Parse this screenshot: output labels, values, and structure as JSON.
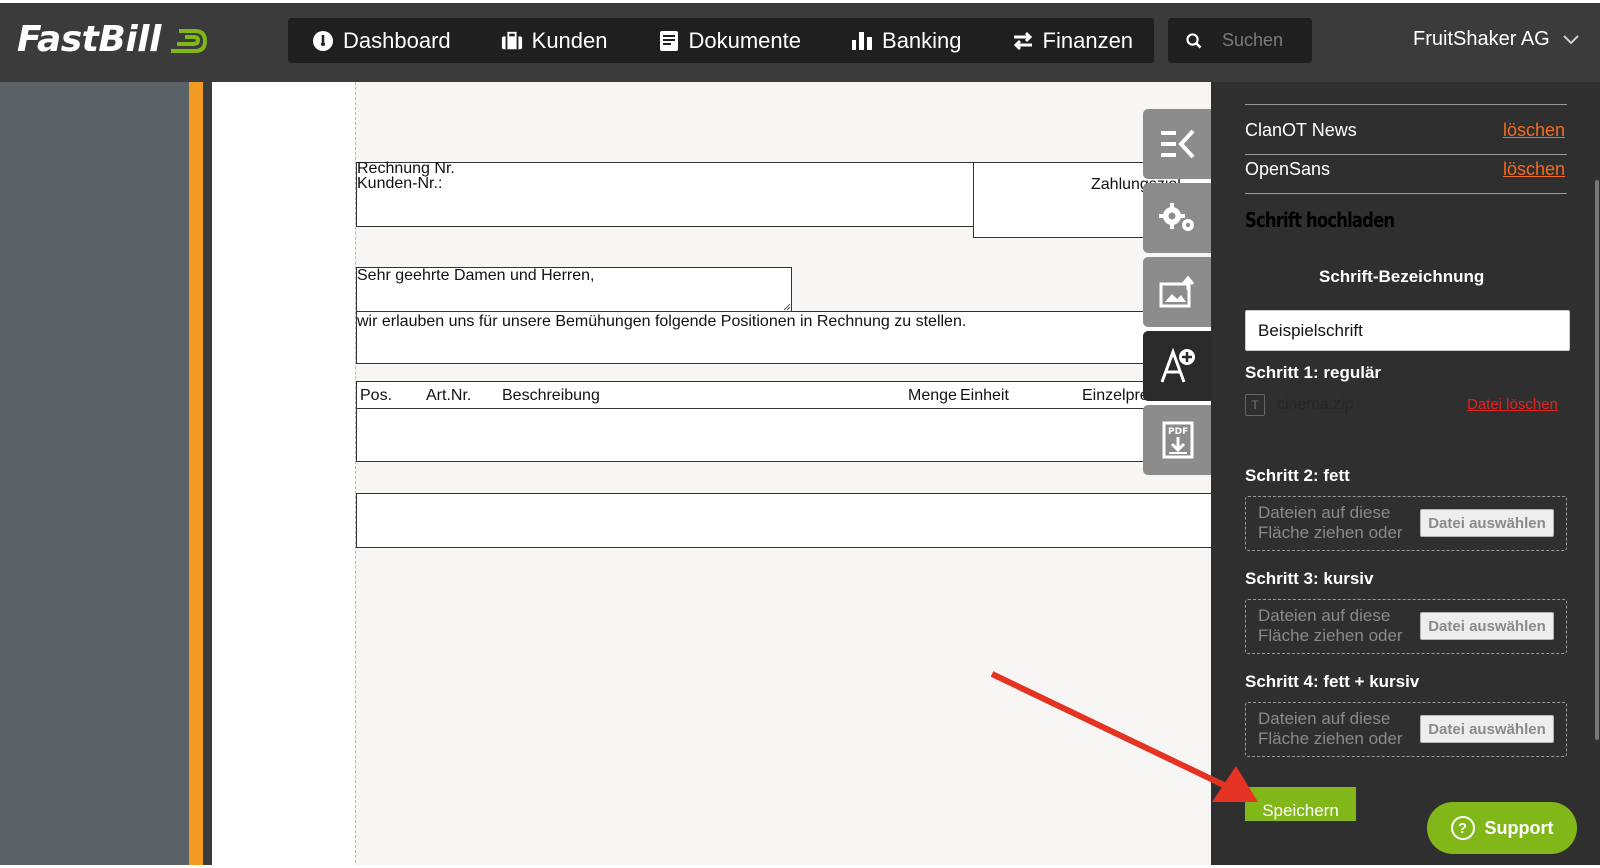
{
  "brand": {
    "name": "FastBill",
    "accent": "#82b71a",
    "orange": "#f39a22"
  },
  "nav": [
    {
      "label": "Dashboard",
      "icon": "dashboard-icon"
    },
    {
      "label": "Kunden",
      "icon": "briefcase-icon"
    },
    {
      "label": "Dokumente",
      "icon": "document-icon"
    },
    {
      "label": "Banking",
      "icon": "bar-chart-icon"
    },
    {
      "label": "Finanzen",
      "icon": "transfer-arrows-icon"
    }
  ],
  "search": {
    "placeholder": "Suchen"
  },
  "account": {
    "name": "FruitShaker AG"
  },
  "document": {
    "invoice_no": "Rechnung Nr.",
    "customer_no": "Kunden-Nr.:",
    "payment_due": "Zahlungsziel",
    "greeting": "Sehr geehrte Damen und Herren,",
    "intro": "wir erlauben uns für unsere Bemühungen folgende Positionen in Rechnung zu stellen.",
    "columns": [
      "Pos.",
      "Art.Nr.",
      "Beschreibung",
      "Menge",
      "Einheit",
      "Einzelpreis"
    ]
  },
  "tools": [
    "collapse-icon",
    "settings-gears-icon",
    "image-upload-icon",
    "font-add-icon",
    "pdf-download-icon"
  ],
  "panel": {
    "fonts": [
      {
        "name": "ClanOT News",
        "action": "löschen"
      },
      {
        "name": "OpenSans",
        "action": "löschen"
      }
    ],
    "upload_title": "Schrift hochladen",
    "name_label": "Schrift-Bezeichnung",
    "name_value": "Beispielschrift",
    "step1_label": "Schritt 1: regulär",
    "step1_file": "cinema.zip",
    "step1_delete": "Datei löschen",
    "step2_label": "Schritt 2: fett",
    "step3_label": "Schritt 3: kursiv",
    "step4_label": "Schritt 4: fett + kursiv",
    "dropzone_text": "Dateien auf diese Fläche ziehen oder",
    "choose_file": "Datei auswählen",
    "save": "Speichern"
  },
  "support": {
    "label": "Support"
  }
}
